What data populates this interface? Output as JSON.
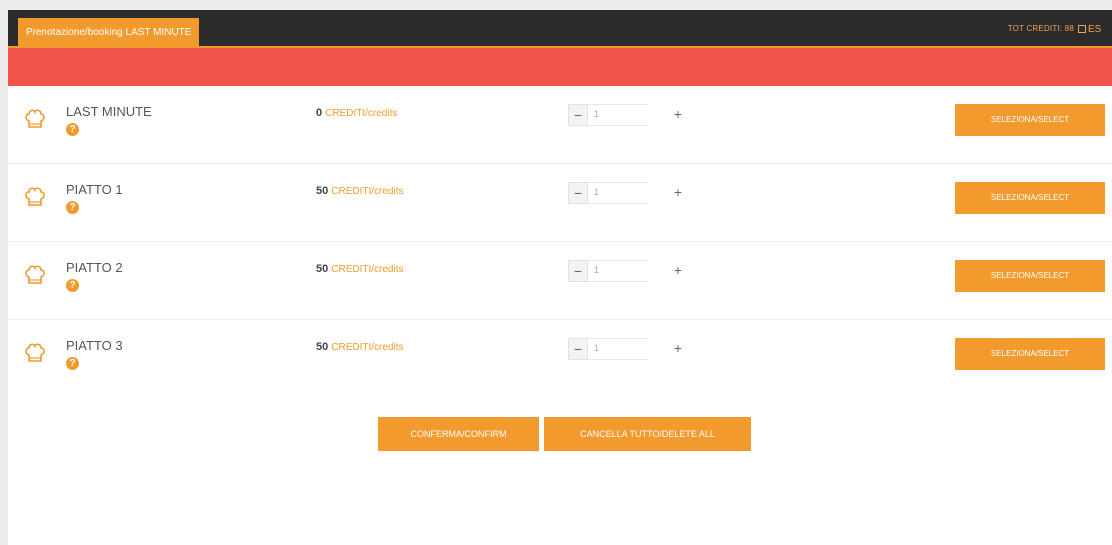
{
  "header": {
    "tab_label": "Prenotazione/booking LAST MINUTE",
    "credits_label": "TOT CREDITI: 88",
    "logout_label": "ES"
  },
  "items": [
    {
      "name": "LAST MINUTE",
      "credits": "0",
      "credits_unit": "CREDITI/credits",
      "qty_value": "1",
      "select_label": "SELEZIONA/SELECT"
    },
    {
      "name": "PIATTO 1",
      "credits": "50",
      "credits_unit": "CREDITI/credits",
      "qty_value": "1",
      "select_label": "SELEZIONA/SELECT"
    },
    {
      "name": "PIATTO 2",
      "credits": "50",
      "credits_unit": "CREDITI/credits",
      "qty_value": "1",
      "select_label": "SELEZIONA/SELECT"
    },
    {
      "name": "PIATTO 3",
      "credits": "50",
      "credits_unit": "CREDITI/credits",
      "qty_value": "1",
      "select_label": "SELEZIONA/SELECT"
    }
  ],
  "stepper": {
    "minus": "−",
    "plus": "+"
  },
  "help_icon": "?",
  "actions": {
    "confirm_label": "CONFERMA/CONFIRM",
    "delete_all_label": "CANCELLA TUTTO/DELETE ALL"
  },
  "colors": {
    "orange": "#f29a2e",
    "red_banner": "#f0544a",
    "topbar": "#2b2b2b"
  }
}
